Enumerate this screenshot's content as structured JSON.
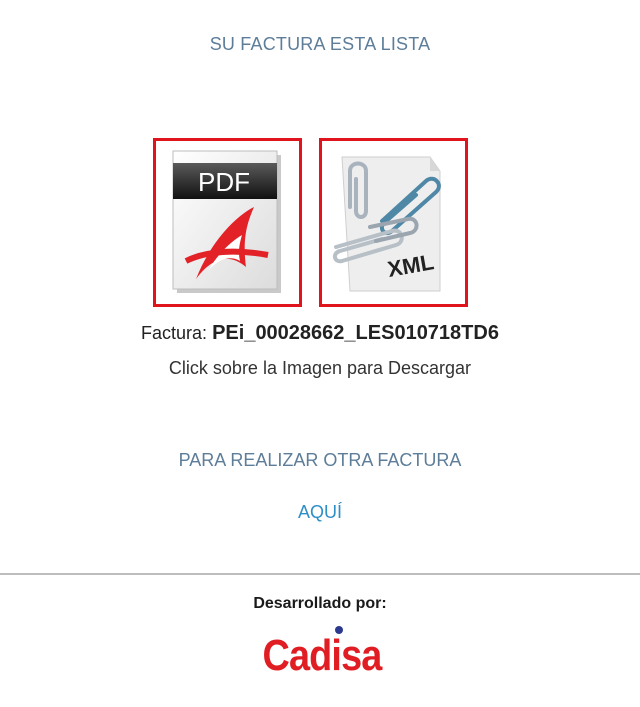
{
  "header": {
    "title": "SU FACTURA ESTA LISTA"
  },
  "files": {
    "pdf": {
      "label": "PDF"
    },
    "xml": {
      "label": "XML"
    }
  },
  "invoice": {
    "label": "Factura:",
    "number": "PEi_00028662_LES010718TD6",
    "hint": "Click sobre la Imagen para Descargar"
  },
  "again": {
    "text": "PARA REALIZAR OTRA FACTURA",
    "link_label": "AQUÍ"
  },
  "footer": {
    "developed_by": "Desarrollado por:",
    "brand": "Cadisa"
  },
  "colors": {
    "accent_red": "#e0141c",
    "heading_gray_blue": "#5d7d99",
    "link_blue": "#2e8fc7",
    "brand_red": "#e11d24"
  }
}
